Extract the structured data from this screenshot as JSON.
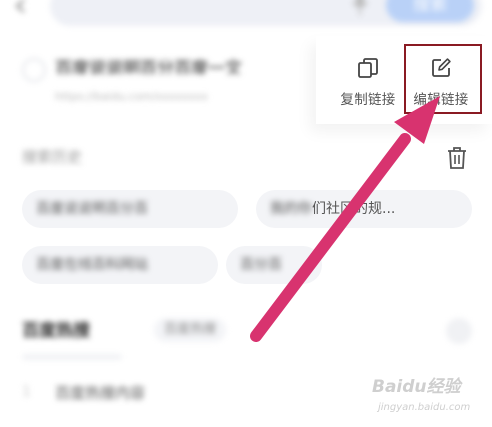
{
  "search": {
    "button_label": "搜索"
  },
  "link_row": {
    "title": "百度说说明百分百度一文",
    "url": "https://baidu.com/xxxxxxxx"
  },
  "actions": {
    "copy_label": "复制链接",
    "edit_label": "编辑链接"
  },
  "history": {
    "title": "搜索历史",
    "chips": [
      {
        "label": "百度说说明百分百"
      },
      {
        "label_blurred": "我的你",
        "label_clear": "们社区的规..."
      },
      {
        "label": "百度在线百科网站"
      },
      {
        "label": "百分百"
      }
    ]
  },
  "hot": {
    "title": "百度热搜",
    "tab_label": "百度热搜",
    "items": [
      {
        "index": "1",
        "label": "百度热搜内容"
      }
    ]
  },
  "watermark": {
    "brand": "Baidu经验",
    "domain": "jingyan.baidu.com"
  },
  "colors": {
    "accent_blue": "#b9d1f7",
    "arrow_pink": "#d8336f",
    "highlight_border": "#8a1a23"
  }
}
